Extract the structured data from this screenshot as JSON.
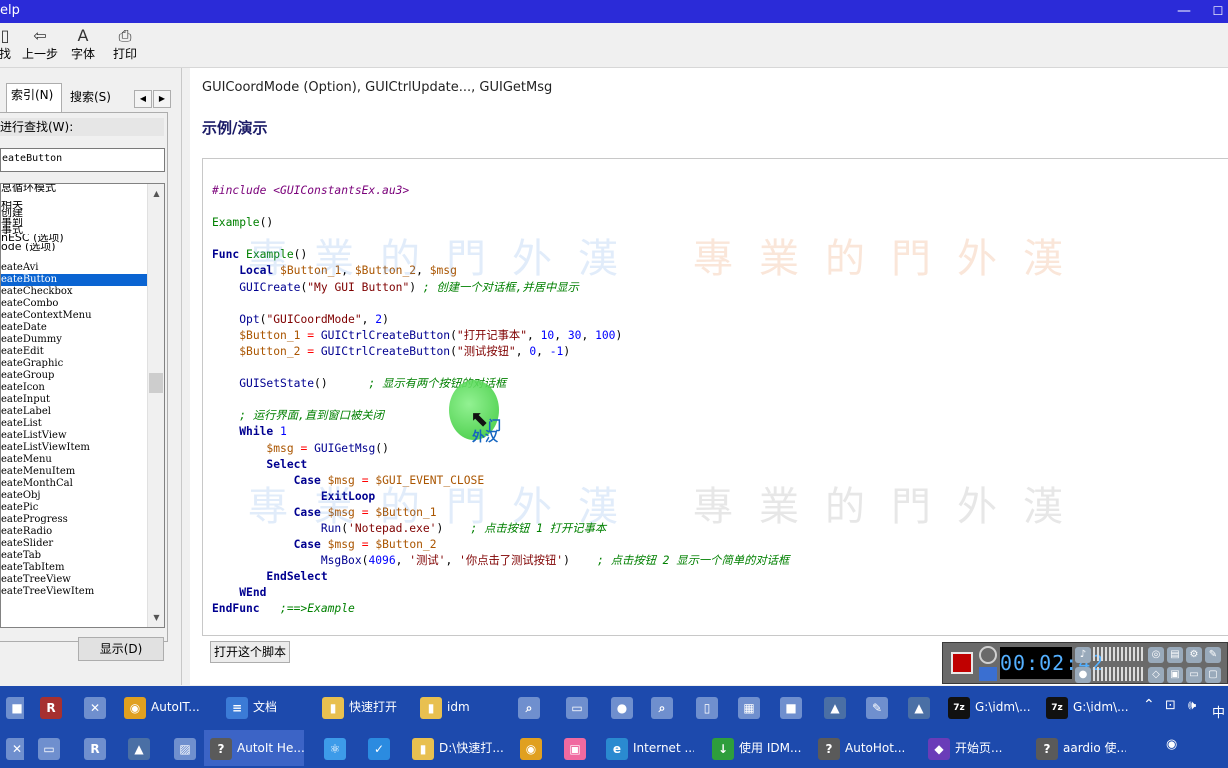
{
  "window": {
    "title": "elp",
    "min_glyph": "—",
    "max_glyph": "☐"
  },
  "toolbar": {
    "items": [
      {
        "label": "找",
        "icon": "find-icon",
        "glyph": "▯"
      },
      {
        "label": "上一步",
        "icon": "back-arrow-icon",
        "glyph": "⇦"
      },
      {
        "label": "字体",
        "icon": "font-icon",
        "glyph": "A"
      },
      {
        "label": "打印",
        "icon": "printer-icon",
        "glyph": "⎙"
      }
    ]
  },
  "left": {
    "tabs": [
      "索引(N)",
      "搜索(S)"
    ],
    "find_label": "进行查找(W):",
    "find_value": "eateButton",
    "index_top_items": [
      "息循环模式",
      "",
      "相关",
      "创建",
      "事到",
      "事式",
      "nESC (选项)",
      "ode (选项)"
    ],
    "index_items": [
      "eateAvi",
      "eateButton",
      "eateCheckbox",
      "eateCombo",
      "eateContextMenu",
      "eateDate",
      "eateDummy",
      "eateEdit",
      "eateGraphic",
      "eateGroup",
      "eateIcon",
      "eateInput",
      "eateLabel",
      "eateList",
      "eateListView",
      "eateListViewItem",
      "eateMenu",
      "eateMenuItem",
      "eateMonthCal",
      "eateObj",
      "eatePic",
      "eateProgress",
      "eateRadio",
      "eateSlider",
      "eateTab",
      "eateTabItem",
      "eateTreeView",
      "eateTreeViewItem"
    ],
    "selected_item": "eateButton",
    "show_button": "显示(D)"
  },
  "content": {
    "func_list": "GUICoordMode (Option), GUICtrlUpdate..., GUIGetMsg",
    "section_heading": "示例/演示",
    "watermark": "專業的門外漢",
    "overlay_text_1": "门",
    "overlay_text_2": "外汉",
    "open_script_button": "打开这个脚本"
  },
  "recorder": {
    "timer": "00:02:42",
    "accent": "#c00000"
  },
  "taskbar": {
    "row1": [
      {
        "label": "",
        "icon": "app-icon"
      },
      {
        "label": "",
        "icon": "rar-icon"
      },
      {
        "label": "",
        "icon": "tool-icon"
      },
      {
        "label": "AutoIT...",
        "icon": "chrome-icon"
      },
      {
        "label": "文档",
        "icon": "document-icon"
      },
      {
        "label": "快速打开",
        "icon": "folder-icon"
      },
      {
        "label": "idm",
        "icon": "folder-icon"
      },
      {
        "label": "",
        "icon": "search-folder-icon"
      },
      {
        "label": "",
        "icon": "window-icon"
      },
      {
        "label": "",
        "icon": "media-icon"
      },
      {
        "label": "",
        "icon": "magnifier-icon"
      },
      {
        "label": "",
        "icon": "file-icon"
      },
      {
        "label": "",
        "icon": "film-icon"
      },
      {
        "label": "",
        "icon": "app-icon"
      },
      {
        "label": "",
        "icon": "autoit-icon"
      },
      {
        "label": "",
        "icon": "notepad-icon"
      },
      {
        "label": "",
        "icon": "autoit-icon"
      },
      {
        "label": "G:\\idm\\...",
        "icon": "7zip-icon"
      },
      {
        "label": "G:\\idm\\...",
        "icon": "7zip-icon"
      }
    ],
    "row2": [
      {
        "label": "",
        "icon": "tool-icon"
      },
      {
        "label": "",
        "icon": "window-icon"
      },
      {
        "label": "",
        "icon": "r-icon"
      },
      {
        "label": "",
        "icon": "autoit-icon"
      },
      {
        "label": "",
        "icon": "clapper-icon"
      },
      {
        "label": "AutoIt He...",
        "icon": "help-icon"
      },
      {
        "label": "",
        "icon": "atom-icon"
      },
      {
        "label": "",
        "icon": "check-icon"
      },
      {
        "label": "D:\\快速打...",
        "icon": "folder-icon"
      },
      {
        "label": "",
        "icon": "chrome-icon"
      },
      {
        "label": "",
        "icon": "bilibili-icon"
      },
      {
        "label": "Internet ...",
        "icon": "ie-icon"
      },
      {
        "label": "使用 IDM...",
        "icon": "idm-icon"
      },
      {
        "label": "AutoHot...",
        "icon": "help-icon"
      },
      {
        "label": "开始页...",
        "icon": "vs-icon"
      },
      {
        "label": "aardio 使...",
        "icon": "help-icon"
      }
    ],
    "ime": "中"
  }
}
